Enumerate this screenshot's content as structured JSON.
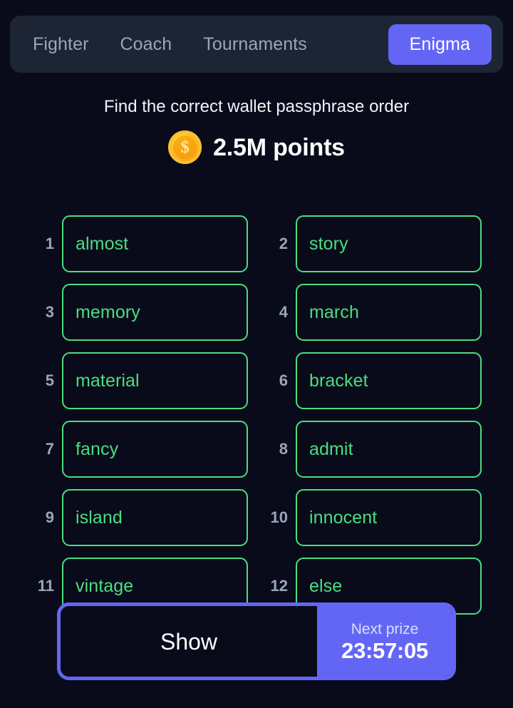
{
  "tabs": [
    {
      "label": "Fighter",
      "active": false
    },
    {
      "label": "Coach",
      "active": false
    },
    {
      "label": "Tournaments",
      "active": false
    },
    {
      "label": "Enigma",
      "active": true
    }
  ],
  "header": {
    "subtitle": "Find the correct wallet passphrase order",
    "points": "2.5M points",
    "coin_icon": "coin-icon",
    "coin_symbol": "$"
  },
  "words": [
    {
      "index": "1",
      "word": "almost"
    },
    {
      "index": "2",
      "word": "story"
    },
    {
      "index": "3",
      "word": "memory"
    },
    {
      "index": "4",
      "word": "march"
    },
    {
      "index": "5",
      "word": "material"
    },
    {
      "index": "6",
      "word": "bracket"
    },
    {
      "index": "7",
      "word": "fancy"
    },
    {
      "index": "8",
      "word": "admit"
    },
    {
      "index": "9",
      "word": "island"
    },
    {
      "index": "10",
      "word": "innocent"
    },
    {
      "index": "11",
      "word": "vintage"
    },
    {
      "index": "12",
      "word": "else"
    }
  ],
  "action": {
    "show_label": "Show",
    "prize_label": "Next prize",
    "timer": "23:57:05"
  },
  "colors": {
    "background": "#090b1a",
    "tabbar_bg": "#1d2433",
    "accent_purple": "#6366f5",
    "word_green": "#4ade80",
    "muted_text": "#9aa6b9",
    "coin_gold": "#fdbe22"
  }
}
